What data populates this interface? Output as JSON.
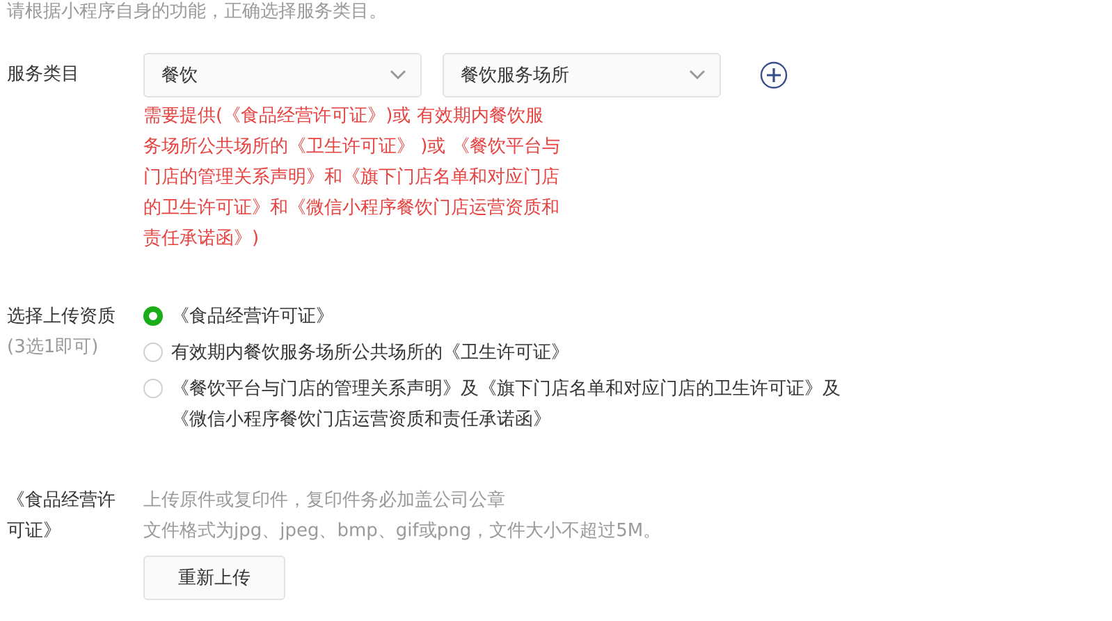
{
  "intro": "请根据小程序自身的功能，正确选择服务类目。",
  "category": {
    "label": "服务类目",
    "selects": [
      {
        "value": "餐饮"
      },
      {
        "value": "餐饮服务场所"
      }
    ],
    "notice": "需要提供(《食品经营许可证》)或 有效期内餐饮服务场所公共场所的《卫生许可证》 )或 《餐饮平台与门店的管理关系声明》和《旗下门店名单和对应门店的卫生许可证》和《微信小程序餐饮门店运营资质和责任承诺函》)"
  },
  "qualification": {
    "label": "选择上传资质",
    "hint": "(3选1即可)",
    "options": [
      {
        "text": "《食品经营许可证》",
        "selected": true
      },
      {
        "text": "有效期内餐饮服务场所公共场所的《卫生许可证》",
        "selected": false
      },
      {
        "text": "《餐饮平台与门店的管理关系声明》及《旗下门店名单和对应门店的卫生许可证》及《微信小程序餐饮门店运营资质和责任承诺函》",
        "selected": false
      }
    ]
  },
  "upload": {
    "label": "《食品经营许可证》",
    "notes": [
      "上传原件或复印件，复印件务必加盖公司公章",
      "文件格式为jpg、jpeg、bmp、gif或png，文件大小不超过5M。"
    ],
    "button": "重新上传"
  }
}
